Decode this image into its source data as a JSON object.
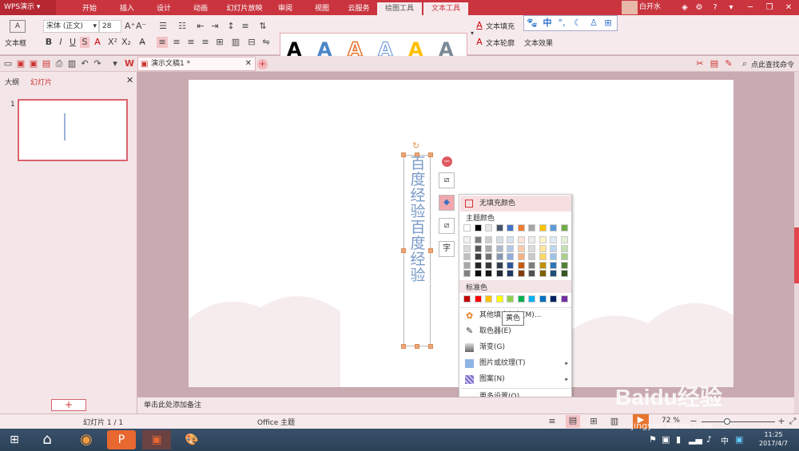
{
  "app": {
    "name": "WPS演示",
    "tabs": [
      "开始",
      "插入",
      "设计",
      "动画",
      "幻灯片放映",
      "审阅",
      "视图",
      "云服务",
      "绘图工具",
      "文本工具"
    ],
    "active_tab": "文本工具",
    "user": "白开水"
  },
  "ribbon": {
    "text_box": "文本框",
    "font_name": "宋体 (正文)",
    "font_size": "28",
    "fill": "文本填充",
    "outline": "文本轮廓",
    "effect": "文本效果",
    "ime": "中"
  },
  "quickbar": {
    "doc_tab": "演示文稿1 *",
    "search": "点此查找命令"
  },
  "left": {
    "outline_tab": "大纲",
    "slides_tab": "幻灯片",
    "slide_num": "1"
  },
  "slide": {
    "vertical_text": [
      "百",
      "度",
      "经",
      "验",
      "百",
      "度",
      "经",
      "验"
    ]
  },
  "popup": {
    "no_fill": "无填充颜色",
    "theme_colors": "主题颜色",
    "standard": "标准色",
    "more_fill": "其他填充颜色(M)...",
    "eyedropper": "取色器(E)",
    "gradient": "渐变(G)",
    "picture": "图片或纹理(T)",
    "pattern": "图案(N)",
    "more_settings": "更多设置(O)...",
    "tooltip": "黄色",
    "theme_top": [
      "#ffffff",
      "#000000",
      "#e7e6e6",
      "#44546a",
      "#4472c4",
      "#ed7d31",
      "#a5a5a5",
      "#ffc000",
      "#5b9bd5",
      "#70ad47"
    ],
    "theme_cols": [
      [
        "#f2f2f2",
        "#d9d9d9",
        "#bfbfbf",
        "#a6a6a6",
        "#808080"
      ],
      [
        "#7f7f7f",
        "#595959",
        "#404040",
        "#262626",
        "#0d0d0d"
      ],
      [
        "#d0cece",
        "#aeaaaa",
        "#757171",
        "#3a3838",
        "#171616"
      ],
      [
        "#d6dce5",
        "#adb9ca",
        "#8497b0",
        "#333f50",
        "#222a35"
      ],
      [
        "#dae3f3",
        "#b4c7e7",
        "#8faadc",
        "#2f5597",
        "#1f3864"
      ],
      [
        "#fbe5d6",
        "#f8cbad",
        "#f4b183",
        "#c55a11",
        "#843c0c"
      ],
      [
        "#ededed",
        "#dbdbdb",
        "#c9c9c9",
        "#7b7b7b",
        "#525252"
      ],
      [
        "#fff2cc",
        "#ffe699",
        "#ffd966",
        "#bf9000",
        "#7f6000"
      ],
      [
        "#deebf7",
        "#bdd7ee",
        "#9dc3e6",
        "#2e75b6",
        "#1f4e79"
      ],
      [
        "#e2f0d9",
        "#c5e0b4",
        "#a9d18e",
        "#548235",
        "#385723"
      ]
    ],
    "standard_colors": [
      "#c00000",
      "#ff0000",
      "#ffc000",
      "#ffff00",
      "#92d050",
      "#00b050",
      "#00b0f0",
      "#0070c0",
      "#002060",
      "#7030a0"
    ]
  },
  "notes": "单击此处添加备注",
  "status": {
    "slide": "幻灯片 1 / 1",
    "theme": "Office 主题",
    "zoom": "72 %"
  },
  "taskbar": {
    "time": "11:25",
    "date": "2017/4/7",
    "ime": "中"
  },
  "watermark": {
    "text": "Baidu经验",
    "url": "jingyan.baidu.com"
  }
}
